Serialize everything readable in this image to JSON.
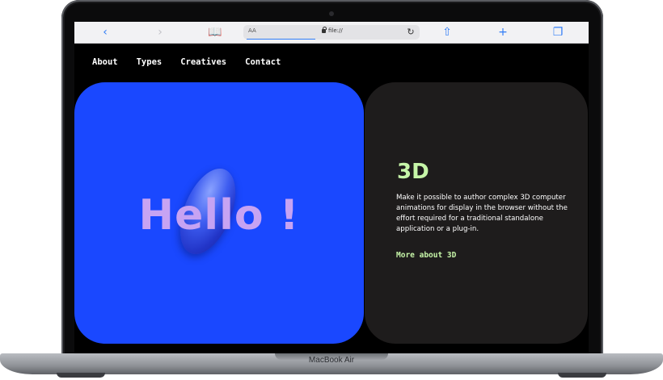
{
  "device": {
    "model_label": "MacBook Air"
  },
  "browser": {
    "reader_label": "AA",
    "url": "file://",
    "icons": [
      "back-icon",
      "forward-icon",
      "bookmarks-icon",
      "lock-icon",
      "reload-icon",
      "share-icon",
      "new-tab-icon",
      "tabs-icon"
    ]
  },
  "nav": {
    "items": [
      {
        "label": "About"
      },
      {
        "label": "Types"
      },
      {
        "label": "Creatives"
      },
      {
        "label": "Contact"
      }
    ]
  },
  "hero": {
    "text": "Hello !",
    "bg_color": "#1a48ff",
    "text_color": "#c7a3f3"
  },
  "info": {
    "title": "3D",
    "body": "Make it possible to author complex 3D computer animations for display in the browser without the effort required for a traditional standalone application or a plug-in.",
    "link_label": "More about 3D",
    "accent_color": "#c6f5a8"
  }
}
